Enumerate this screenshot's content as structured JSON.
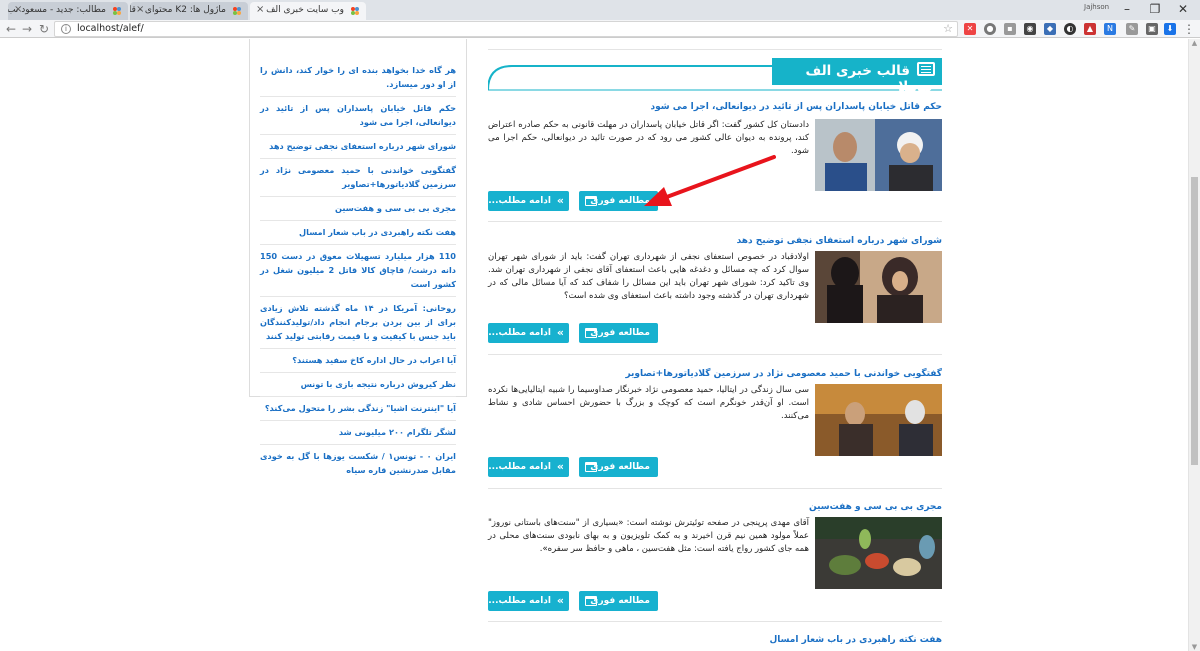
{
  "browser": {
    "tabs": [
      {
        "title": "وب سایت خبری الف",
        "active": true
      },
      {
        "title": "ماژول ها: K2 محتوای - قا...",
        "active": false
      },
      {
        "title": "مطالب: جدید - مسعود نب...",
        "active": false
      }
    ],
    "url": "localhost/alef/",
    "profile_label": "Jajhson"
  },
  "sidebar": {
    "items": [
      "هر گاه خدا بخواهد بنده ای را خوار کند، دانش را از او دور میسازد.",
      "حکم قاتل خیابان پاسداران پس از تائید در دیوانعالی، اجرا می شود",
      "شورای شهر درباره استعفای نجفی توضیح دهد",
      "گفتگویی خواندنی با حمید معصومی نژاد در سرزمین گلادیاتورها+تصاویر",
      "مجری بی بی سی و هفت‌سین",
      "هفت نکته راهبردی در باب شعار امسال",
      "110 هزار میلیارد تسهیلات معوق در دست 150 دانه درشت/ قاچاق کالا قاتل 2 میلیون شغل در کشور است",
      "روحانی: آمریکا در ۱۴ ماه گذشته تلاش زیادی برای از بین بردن برجام انجام داد/تولیدکنندگان باید جنس با کیفیت و با قیمت رقابتی تولید کنند",
      "آیا اعراب در حال اداره کاخ سفید هستند؟",
      "نظر کیروش درباره نتیجه بازی با تونس",
      "آیا \"اینترنت اشیا\" زندگی بشر را متحول می‌کند؟",
      "لشگر تلگرام ۲۰۰ میلیونی شد",
      "ایران ۰ - تونس۱ / شکست یوزها با گل به خودی مقابل صدرنشین قاره سیاه"
    ]
  },
  "main": {
    "heading": "قالب خبری الف جوملا",
    "read_button_label": "مطالعه فوری",
    "more_button_label": "ادامه مطلب...",
    "articles": [
      {
        "title": "حکم قاتل خیابان پاسداران پس از تائید در دیوانعالی، اجرا می شود",
        "text": "دادستان کل کشور گفت: اگر قاتل خیابان پاسداران در مهلت قانونی به حکم صادره اعتراض کند، پرونده به دیوان عالی کشور می رود که در صورت تائید در دیوانعالی، حکم اجرا می شود."
      },
      {
        "title": "شورای شهر درباره استعفای نجفی توضیح دهد",
        "text": "اولادقباد در خصوص استعفای نجفی از شهرداری تهران گفت: باید از شورای شهر تهران سوال کرد که چه مسائل و دغدغه هایی باعث استعفای آقای نجفی از شهرداری تهران شد. وی تاکید کرد: شورای شهر تهران باید این مسائل را شفاف کند که آیا مسائل مالی که در شهرداری تهران در گذشته وجود داشته باعث استعفای وی شده است؟"
      },
      {
        "title": "گفتگویی خواندنی با حمید معصومی نژاد در سرزمین گلادیاتورها+تصاویر",
        "text": "سی سال زندگی در ایتالیا، حمید معصومی نژاد خبرنگار صداوسیما را شبیه ایتالیایی‌ها نکرده است. او آن‌قدر خونگرم است که کوچک و بزرگ با حضورش احساس شادی و نشاط می‌کنند."
      },
      {
        "title": "مجری بی بی سی و هفت‌سین",
        "text": "آقای مهدی پرپنجی در صفحه توئیترش نوشته است: «بسیاری از \"سنت‌های باستانی نوروز\" عملاً مولود همین نیم قرن اخیرند و به کمک تلویزیون و به بهای نابودی سنت‌های محلی در همه جای کشور رواج یافته است: مثل هفت‌سین ، ماهی و حافظ سر سفره»."
      },
      {
        "title": "هفت نکته راهبردی در باب شعار امسال",
        "text": ""
      }
    ]
  },
  "colors": {
    "accent": "#16b3c9",
    "button": "#17b1cf",
    "link": "#1a6fc4",
    "arrow": "#e8141c"
  }
}
